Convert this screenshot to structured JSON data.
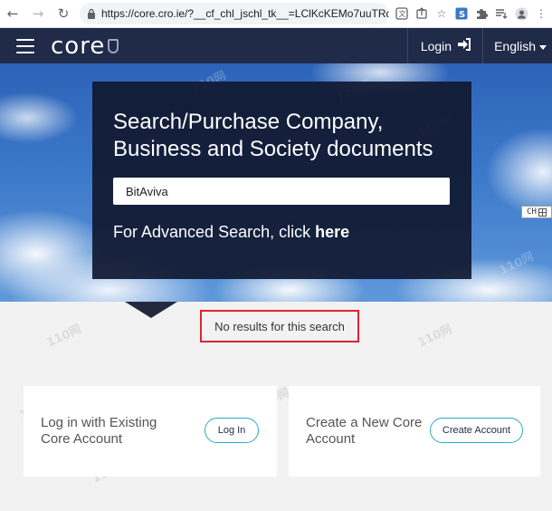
{
  "browser": {
    "url": "https://core.cro.ie/?__cf_chl_jschl_tk__=LClKcKEMo7uuTRqE...",
    "icons": [
      "back-icon",
      "forward-icon",
      "reload-icon",
      "lock-icon",
      "translate-icon",
      "share-icon",
      "star-icon",
      "extension-s-icon",
      "puzzle-icon",
      "queue-icon",
      "profile-icon",
      "menu-dots-icon"
    ]
  },
  "header": {
    "logo_text": "core",
    "login_label": "Login",
    "language_label": "English"
  },
  "hero": {
    "title": "Search/Purchase Company, Business and Society documents",
    "search_value": "BitAviva",
    "advanced_prefix": "For Advanced Search, click ",
    "advanced_link": "here"
  },
  "badge": {
    "label": "CH"
  },
  "results": {
    "message": "No results for this search"
  },
  "accounts": {
    "existing_text": "Log in with Existing Core Account",
    "existing_button": "Log In",
    "new_text": "Create a New Core Account",
    "new_button": "Create Account"
  },
  "watermark": {
    "text": "110网"
  },
  "colors": {
    "header_bg": "#1f2b48",
    "card_bg": "#101830",
    "highlight_border": "#e0242f",
    "button_border": "#2ea7c9"
  }
}
